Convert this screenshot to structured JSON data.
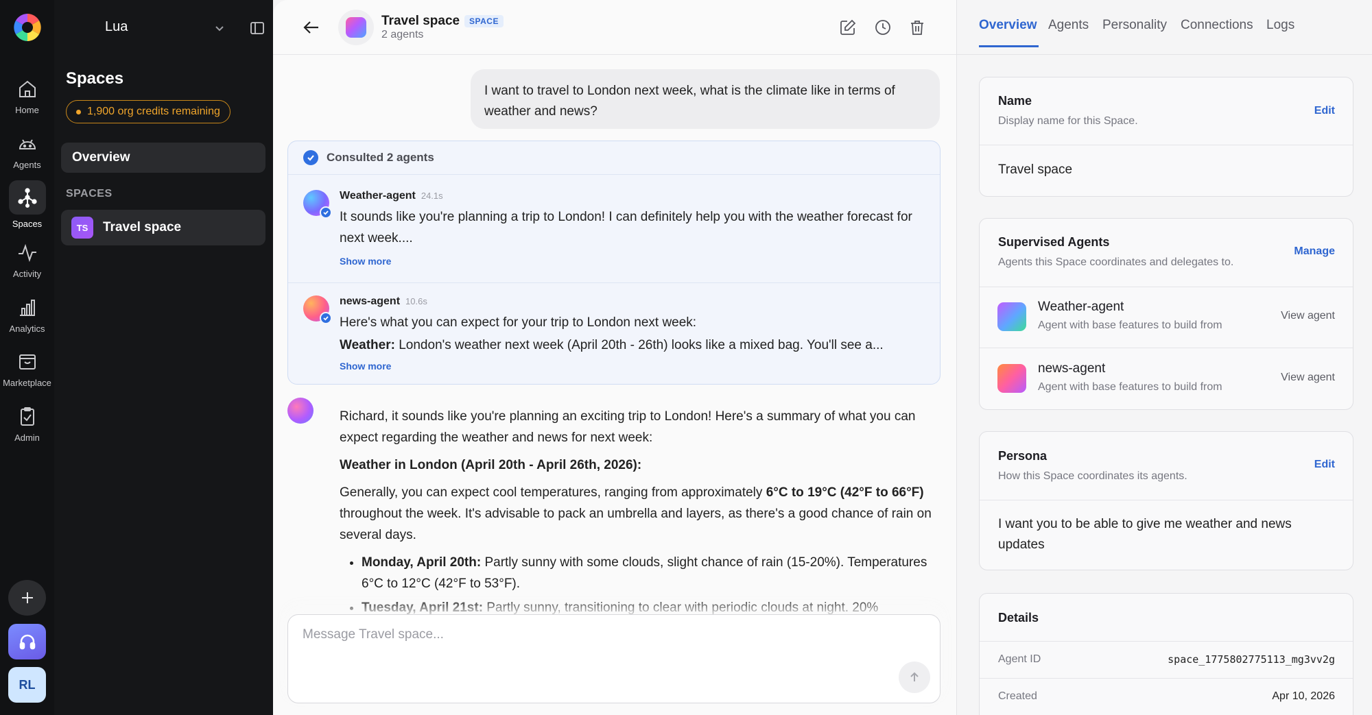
{
  "rail": {
    "items": [
      {
        "label": "Home",
        "icon": "home-icon"
      },
      {
        "label": "Agents",
        "icon": "robot-icon"
      },
      {
        "label": "Spaces",
        "icon": "hub-icon"
      },
      {
        "label": "Activity",
        "icon": "activity-icon"
      },
      {
        "label": "Analytics",
        "icon": "bar-chart-icon"
      },
      {
        "label": "Marketplace",
        "icon": "inbox-icon"
      },
      {
        "label": "Admin",
        "icon": "clipboard-check-icon"
      }
    ],
    "active": "Spaces",
    "user_initials": "RL"
  },
  "sidebar": {
    "org_name": "Lua",
    "title": "Spaces",
    "credits": "1,900 org credits remaining",
    "overview_label": "Overview",
    "section_label": "SPACES",
    "space_initials": "TS",
    "space_name": "Travel space"
  },
  "header": {
    "title": "Travel space",
    "tag": "SPACE",
    "subtitle": "2 agents"
  },
  "chat": {
    "user_message": "I want to travel to London next week, what is the climate like in terms of weather and news?",
    "consult_label": "Consulted 2 agents",
    "agents": [
      {
        "name": "Weather-agent",
        "time": "24.1s",
        "text": "It sounds like you're planning a trip to London! I can definitely help you with the weather forecast for next week....",
        "show_more": "Show more"
      },
      {
        "name": "news-agent",
        "time": "10.6s",
        "line1": "Here's what you can expect for your trip to London next week:",
        "line2_bold": "Weather:",
        "line2_rest": " London's weather next week (April 20th - 26th) looks like a mixed bag. You'll see a...",
        "show_more": "Show more"
      }
    ],
    "reply": {
      "intro": "Richard, it sounds like you're planning an exciting trip to London! Here's a summary of what you can expect regarding the weather and news for next week:",
      "heading": "Weather in London (April 20th - April 26th, 2026):",
      "para_pre": "Generally, you can expect cool temperatures, ranging from approximately ",
      "para_bold": "6°C to 19°C (42°F to 66°F)",
      "para_post": " throughout the week. It's advisable to pack an umbrella and layers, as there's a good chance of rain on several days.",
      "bullets": [
        {
          "bold": "Monday, April 20th:",
          "text": " Partly sunny with some clouds, slight chance of rain (15-20%). Temperatures 6°C to 12°C (42°F to 53°F)."
        },
        {
          "bold": "Tuesday, April 21st:",
          "text": " Partly sunny, transitioning to clear with periodic clouds at night. 20%"
        }
      ]
    },
    "composer_placeholder": "Message Travel space..."
  },
  "right_panel": {
    "tabs": [
      "Overview",
      "Agents",
      "Personality",
      "Connections",
      "Logs"
    ],
    "active_tab": "Overview",
    "name_card": {
      "title": "Name",
      "subtitle": "Display name for this Space.",
      "action": "Edit",
      "value": "Travel space"
    },
    "agents_card": {
      "title": "Supervised Agents",
      "subtitle": "Agents this Space coordinates and delegates to.",
      "action": "Manage",
      "agents": [
        {
          "name": "Weather-agent",
          "desc": "Agent with base features to build from",
          "action": "View agent"
        },
        {
          "name": "news-agent",
          "desc": "Agent with base features to build from",
          "action": "View agent"
        }
      ]
    },
    "persona_card": {
      "title": "Persona",
      "subtitle": "How this Space coordinates its agents.",
      "action": "Edit",
      "value": "I want you to be able to give me weather and news updates"
    },
    "details_card": {
      "title": "Details",
      "rows": [
        {
          "key": "Agent ID",
          "value": "space_1775802775113_mg3vv2g"
        },
        {
          "key": "Created",
          "value": "Apr 10, 2026"
        }
      ]
    }
  },
  "colors": {
    "accent": "#2f66d0",
    "credits": "#f0a52b",
    "rail_bg": "#111214",
    "sidebar_bg": "#151618"
  }
}
